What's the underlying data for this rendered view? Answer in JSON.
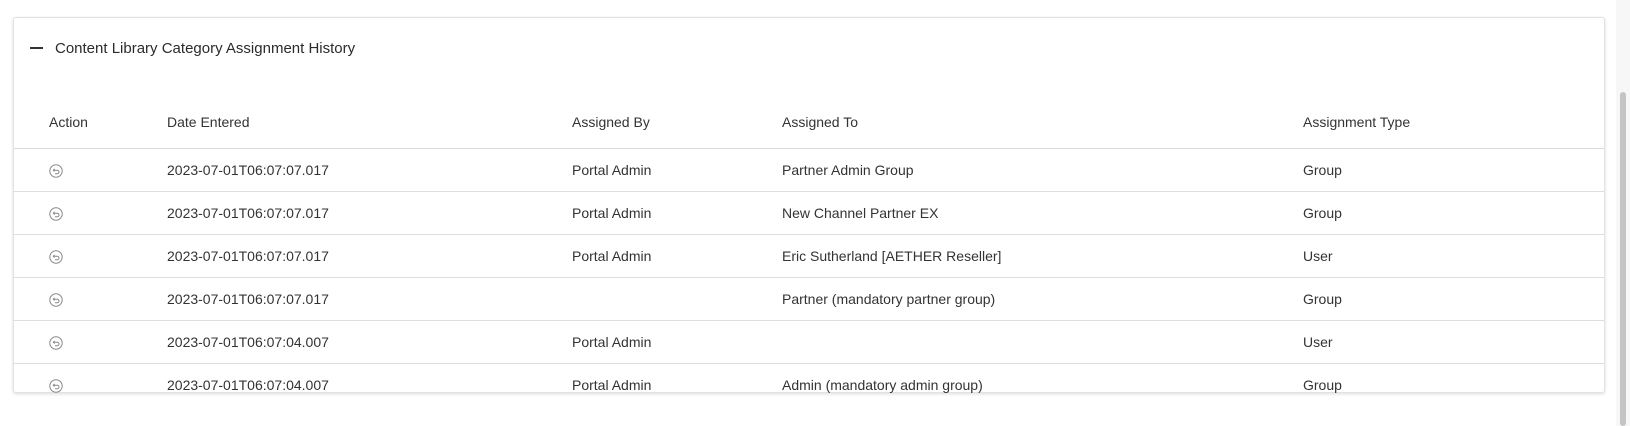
{
  "panel": {
    "title": "Content Library Category Assignment History"
  },
  "table": {
    "columns": [
      "Action",
      "Date Entered",
      "Assigned By",
      "Assigned To",
      "Assignment Type"
    ],
    "rows": [
      {
        "action_icon": "undo-icon",
        "date_entered": "2023-07-01T06:07:07.017",
        "assigned_by": "Portal Admin",
        "assigned_to": "Partner Admin Group",
        "assignment_type": "Group"
      },
      {
        "action_icon": "undo-icon",
        "date_entered": "2023-07-01T06:07:07.017",
        "assigned_by": "Portal Admin",
        "assigned_to": "New Channel Partner EX",
        "assignment_type": "Group"
      },
      {
        "action_icon": "undo-icon",
        "date_entered": "2023-07-01T06:07:07.017",
        "assigned_by": "Portal Admin",
        "assigned_to": "Eric Sutherland [AETHER Reseller]",
        "assignment_type": "User"
      },
      {
        "action_icon": "undo-icon",
        "date_entered": "2023-07-01T06:07:07.017",
        "assigned_by": "",
        "assigned_to": "Partner (mandatory partner group)",
        "assignment_type": "Group"
      },
      {
        "action_icon": "undo-icon",
        "date_entered": "2023-07-01T06:07:04.007",
        "assigned_by": "Portal Admin",
        "assigned_to": "",
        "assignment_type": "User"
      },
      {
        "action_icon": "undo-icon",
        "date_entered": "2023-07-01T06:07:04.007",
        "assigned_by": "Portal Admin",
        "assigned_to": "Admin (mandatory admin group)",
        "assignment_type": "Group"
      }
    ]
  }
}
